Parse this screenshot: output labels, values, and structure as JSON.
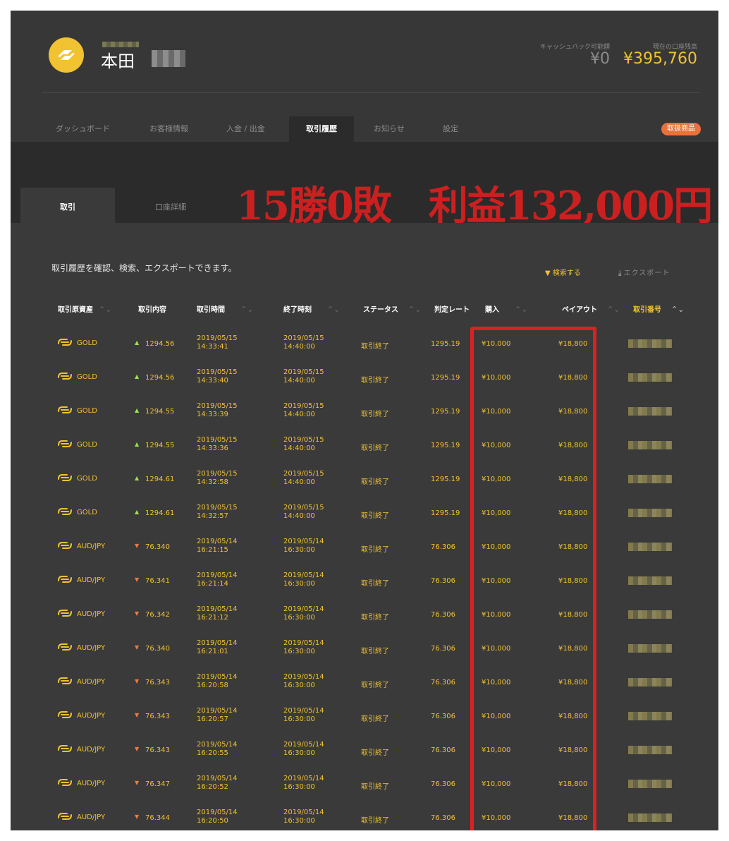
{
  "header": {
    "user_name": "本田",
    "cashback_label": "キャッシュバック可能額",
    "cashback_value": "¥0",
    "balance_label": "現在の口座残高",
    "balance_value": "¥395,760"
  },
  "nav": {
    "items": [
      "ダッシュボード",
      "お客様情報",
      "入金 / 出金",
      "取引履歴",
      "お知らせ",
      "設定"
    ],
    "active": "取引履歴",
    "badge": "取扱商品"
  },
  "subtabs": [
    "取引",
    "口座詳細"
  ],
  "headline": "15勝0敗　利益132,000円",
  "description": "取引履歴を確認、検索、エクスポートできます。",
  "actions": {
    "search": "検索する",
    "export": "エクスポート"
  },
  "table": {
    "columns": [
      "取引原資産",
      "取引内容",
      "取引時間",
      "終了時刻",
      "ステータス",
      "判定レート",
      "購入",
      "ペイアウト",
      "取引番号"
    ],
    "rows": [
      {
        "asset": "GOLD",
        "direction": "up",
        "content": "1294.56",
        "trade_date": "2019/05/15",
        "trade_time": "14:33:41",
        "end_date": "2019/05/15",
        "end_time": "14:40:00",
        "status": "取引終了",
        "rate": "1295.19",
        "buy": "¥10,000",
        "payout": "¥18,800"
      },
      {
        "asset": "GOLD",
        "direction": "up",
        "content": "1294.56",
        "trade_date": "2019/05/15",
        "trade_time": "14:33:40",
        "end_date": "2019/05/15",
        "end_time": "14:40:00",
        "status": "取引終了",
        "rate": "1295.19",
        "buy": "¥10,000",
        "payout": "¥18,800"
      },
      {
        "asset": "GOLD",
        "direction": "up",
        "content": "1294.55",
        "trade_date": "2019/05/15",
        "trade_time": "14:33:39",
        "end_date": "2019/05/15",
        "end_time": "14:40:00",
        "status": "取引終了",
        "rate": "1295.19",
        "buy": "¥10,000",
        "payout": "¥18,800"
      },
      {
        "asset": "GOLD",
        "direction": "up",
        "content": "1294.55",
        "trade_date": "2019/05/15",
        "trade_time": "14:33:36",
        "end_date": "2019/05/15",
        "end_time": "14:40:00",
        "status": "取引終了",
        "rate": "1295.19",
        "buy": "¥10,000",
        "payout": "¥18,800"
      },
      {
        "asset": "GOLD",
        "direction": "up",
        "content": "1294.61",
        "trade_date": "2019/05/15",
        "trade_time": "14:32:58",
        "end_date": "2019/05/15",
        "end_time": "14:40:00",
        "status": "取引終了",
        "rate": "1295.19",
        "buy": "¥10,000",
        "payout": "¥18,800"
      },
      {
        "asset": "GOLD",
        "direction": "up",
        "content": "1294.61",
        "trade_date": "2019/05/15",
        "trade_time": "14:32:57",
        "end_date": "2019/05/15",
        "end_time": "14:40:00",
        "status": "取引終了",
        "rate": "1295.19",
        "buy": "¥10,000",
        "payout": "¥18,800"
      },
      {
        "asset": "AUD/JPY",
        "direction": "down",
        "content": "76.340",
        "trade_date": "2019/05/14",
        "trade_time": "16:21:15",
        "end_date": "2019/05/14",
        "end_time": "16:30:00",
        "status": "取引終了",
        "rate": "76.306",
        "buy": "¥10,000",
        "payout": "¥18,800"
      },
      {
        "asset": "AUD/JPY",
        "direction": "down",
        "content": "76.341",
        "trade_date": "2019/05/14",
        "trade_time": "16:21:14",
        "end_date": "2019/05/14",
        "end_time": "16:30:00",
        "status": "取引終了",
        "rate": "76.306",
        "buy": "¥10,000",
        "payout": "¥18,800"
      },
      {
        "asset": "AUD/JPY",
        "direction": "down",
        "content": "76.342",
        "trade_date": "2019/05/14",
        "trade_time": "16:21:12",
        "end_date": "2019/05/14",
        "end_time": "16:30:00",
        "status": "取引終了",
        "rate": "76.306",
        "buy": "¥10,000",
        "payout": "¥18,800"
      },
      {
        "asset": "AUD/JPY",
        "direction": "down",
        "content": "76.340",
        "trade_date": "2019/05/14",
        "trade_time": "16:21:01",
        "end_date": "2019/05/14",
        "end_time": "16:30:00",
        "status": "取引終了",
        "rate": "76.306",
        "buy": "¥10,000",
        "payout": "¥18,800"
      },
      {
        "asset": "AUD/JPY",
        "direction": "down",
        "content": "76.343",
        "trade_date": "2019/05/14",
        "trade_time": "16:20:58",
        "end_date": "2019/05/14",
        "end_time": "16:30:00",
        "status": "取引終了",
        "rate": "76.306",
        "buy": "¥10,000",
        "payout": "¥18,800"
      },
      {
        "asset": "AUD/JPY",
        "direction": "down",
        "content": "76.343",
        "trade_date": "2019/05/14",
        "trade_time": "16:20:57",
        "end_date": "2019/05/14",
        "end_time": "16:30:00",
        "status": "取引終了",
        "rate": "76.306",
        "buy": "¥10,000",
        "payout": "¥18,800"
      },
      {
        "asset": "AUD/JPY",
        "direction": "down",
        "content": "76.343",
        "trade_date": "2019/05/14",
        "trade_time": "16:20:55",
        "end_date": "2019/05/14",
        "end_time": "16:30:00",
        "status": "取引終了",
        "rate": "76.306",
        "buy": "¥10,000",
        "payout": "¥18,800"
      },
      {
        "asset": "AUD/JPY",
        "direction": "down",
        "content": "76.347",
        "trade_date": "2019/05/14",
        "trade_time": "16:20:52",
        "end_date": "2019/05/14",
        "end_time": "16:30:00",
        "status": "取引終了",
        "rate": "76.306",
        "buy": "¥10,000",
        "payout": "¥18,800"
      },
      {
        "asset": "AUD/JPY",
        "direction": "down",
        "content": "76.344",
        "trade_date": "2019/05/14",
        "trade_time": "16:20:50",
        "end_date": "2019/05/14",
        "end_time": "16:30:00",
        "status": "取引終了",
        "rate": "76.306",
        "buy": "¥10,000",
        "payout": "¥18,800"
      }
    ]
  },
  "colors": {
    "accent": "#f1c232",
    "up": "#9be34a",
    "down": "#f07a3c",
    "highlight": "#dd2020",
    "badge": "#e8733a"
  },
  "icons": {
    "logo": "brand-logo-icon",
    "asset": "asset-link-icon",
    "search": "filter-icon",
    "export": "download-icon",
    "sort": "sort-icon"
  }
}
